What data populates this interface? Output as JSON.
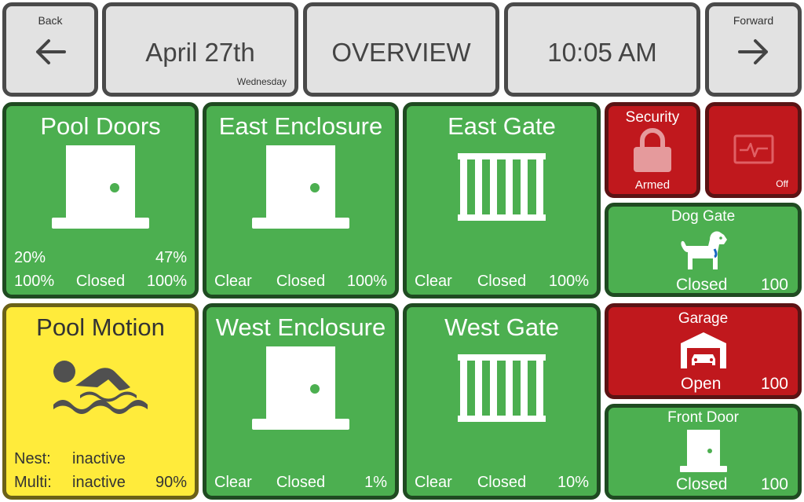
{
  "header": {
    "back_label": "Back",
    "date": "April 27th",
    "weekday": "Wednesday",
    "title": "OVERVIEW",
    "time": "10:05 AM",
    "forward_label": "Forward"
  },
  "tiles": {
    "pool_doors": {
      "title": "Pool Doors",
      "left_top": "20%",
      "right_top": "47%",
      "left": "100%",
      "center": "Closed",
      "right": "100%",
      "icon": "door-icon"
    },
    "east_enclosure": {
      "title": "East Enclosure",
      "left": "Clear",
      "center": "Closed",
      "right": "100%",
      "icon": "door-icon"
    },
    "east_gate": {
      "title": "East Gate",
      "left": "Clear",
      "center": "Closed",
      "right": "100%",
      "icon": "gate-icon"
    },
    "security": {
      "title": "Security",
      "status": "Armed",
      "icon": "lock-icon"
    },
    "monitor": {
      "status": "Off",
      "icon": "monitor-pulse-icon"
    },
    "dog_gate": {
      "title": "Dog Gate",
      "status": "Closed",
      "value": "100",
      "icon": "dog-icon"
    },
    "pool_motion": {
      "title": "Pool Motion",
      "row1_label": "Nest:",
      "row1_value": "inactive",
      "row2_label": "Multi:",
      "row2_value": "inactive",
      "row2_pct": "90%",
      "icon": "swimmer-icon"
    },
    "west_enclosure": {
      "title": "West Enclosure",
      "left": "Clear",
      "center": "Closed",
      "right": "1%",
      "icon": "door-icon"
    },
    "west_gate": {
      "title": "West Gate",
      "left": "Clear",
      "center": "Closed",
      "right": "10%",
      "icon": "gate-icon"
    },
    "garage": {
      "title": "Garage",
      "status": "Open",
      "value": "100",
      "icon": "garage-icon"
    },
    "front_door": {
      "title": "Front Door",
      "status": "Closed",
      "value": "100",
      "icon": "door-icon"
    }
  },
  "colors": {
    "green": "#4caf50",
    "red": "#c0181d",
    "yellow": "#ffeb3b",
    "header_bg": "#e2e2e2"
  }
}
